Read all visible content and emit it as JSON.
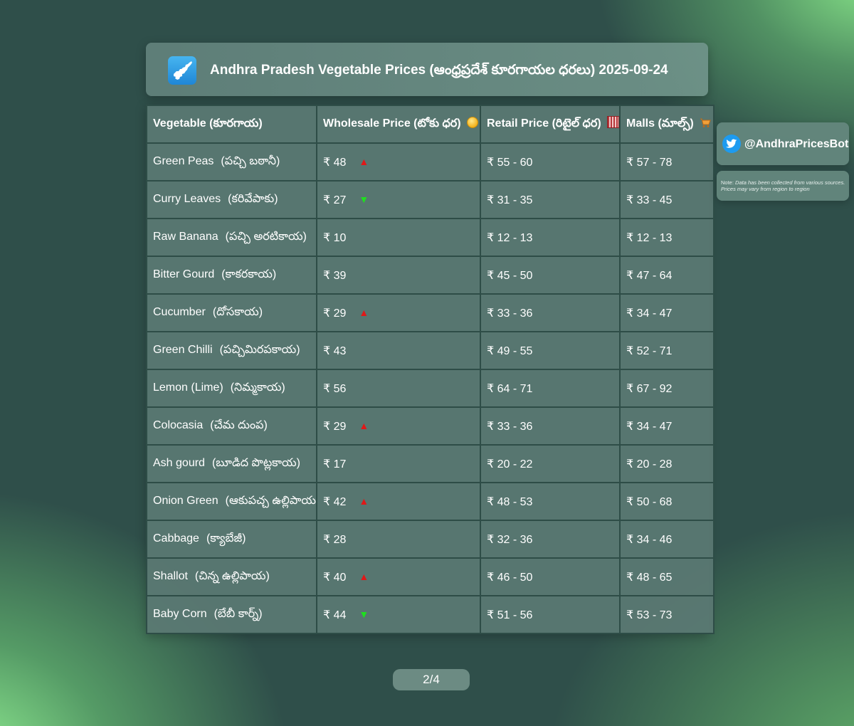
{
  "header": {
    "title": "Andhra Pradesh Vegetable Prices (ఆంధ్రప్రదేశ్ కూరగాయల ధరలు) 2025-09-24",
    "logo_icon": "andhra-pradesh-map-icon"
  },
  "table": {
    "columns": [
      {
        "label": "Vegetable (కూరగాయ)",
        "icon": ""
      },
      {
        "label": "Wholesale Price (టోకు ధర)",
        "icon": "coin-icon"
      },
      {
        "label": "Retail Price (రిటైల్ ధర)",
        "icon": "building-icon"
      },
      {
        "label": "Malls (మాల్స్)",
        "icon": "shopping-cart-icon"
      }
    ],
    "rows": [
      {
        "name": "Green Peas",
        "telugu": "(పచ్చి బఠానీ)",
        "wholesale": "₹ 48",
        "trend": "up",
        "retail": "₹ 55 - 60",
        "malls": "₹ 57 - 78"
      },
      {
        "name": "Curry Leaves",
        "telugu": "(కరివేపాకు)",
        "wholesale": "₹ 27",
        "trend": "down",
        "retail": "₹ 31 - 35",
        "malls": "₹ 33 - 45"
      },
      {
        "name": "Raw Banana",
        "telugu": "(పచ్చి అరటికాయ)",
        "wholesale": "₹ 10",
        "trend": "",
        "retail": "₹ 12 - 13",
        "malls": "₹ 12 - 13"
      },
      {
        "name": "Bitter Gourd",
        "telugu": "(కాకరకాయ)",
        "wholesale": "₹ 39",
        "trend": "",
        "retail": "₹ 45 - 50",
        "malls": "₹ 47 - 64"
      },
      {
        "name": "Cucumber",
        "telugu": "(దోసకాయ)",
        "wholesale": "₹ 29",
        "trend": "up",
        "retail": "₹ 33 - 36",
        "malls": "₹ 34 - 47"
      },
      {
        "name": "Green Chilli",
        "telugu": "(పచ్చిమిరపకాయ)",
        "wholesale": "₹ 43",
        "trend": "",
        "retail": "₹ 49 - 55",
        "malls": "₹ 52 - 71"
      },
      {
        "name": "Lemon (Lime)",
        "telugu": "(నిమ్మకాయ)",
        "wholesale": "₹ 56",
        "trend": "",
        "retail": "₹ 64 - 71",
        "malls": "₹ 67 - 92"
      },
      {
        "name": "Colocasia",
        "telugu": "(చేమ దుంప)",
        "wholesale": "₹ 29",
        "trend": "up",
        "retail": "₹ 33 - 36",
        "malls": "₹ 34 - 47"
      },
      {
        "name": "Ash gourd",
        "telugu": "(బూడిద పొట్లకాయ)",
        "wholesale": "₹ 17",
        "trend": "",
        "retail": "₹ 20 - 22",
        "malls": "₹ 20 - 28"
      },
      {
        "name": "Onion Green",
        "telugu": "(ఆకుపచ్చ ఉల్లిపాయ)",
        "wholesale": "₹ 42",
        "trend": "up",
        "retail": "₹ 48 - 53",
        "malls": "₹ 50 - 68"
      },
      {
        "name": "Cabbage",
        "telugu": "(క్యాబేజీ)",
        "wholesale": "₹ 28",
        "trend": "",
        "retail": "₹ 32 - 36",
        "malls": "₹ 34 - 46"
      },
      {
        "name": "Shallot",
        "telugu": "(చిన్న ఉల్లిపాయ)",
        "wholesale": "₹ 40",
        "trend": "up",
        "retail": "₹ 46 - 50",
        "malls": "₹ 48 - 65"
      },
      {
        "name": "Baby Corn",
        "telugu": "(బేబీ కార్న్)",
        "wholesale": "₹ 44",
        "trend": "down",
        "retail": "₹ 51 - 56",
        "malls": "₹ 53 - 73"
      }
    ]
  },
  "sidebar": {
    "twitter_icon": "twitter-bird-icon",
    "handle": "@AndhraPricesBot",
    "note_prefix": "Note:",
    "note_text": "Data has been collected from various sources. Prices may vary from region to region"
  },
  "pager": {
    "label": "2/4"
  },
  "colors": {
    "trend_up": "#e01818",
    "trend_down": "#1ee01e",
    "background": "#2f4f4a",
    "accent_green": "#8cec8c"
  }
}
